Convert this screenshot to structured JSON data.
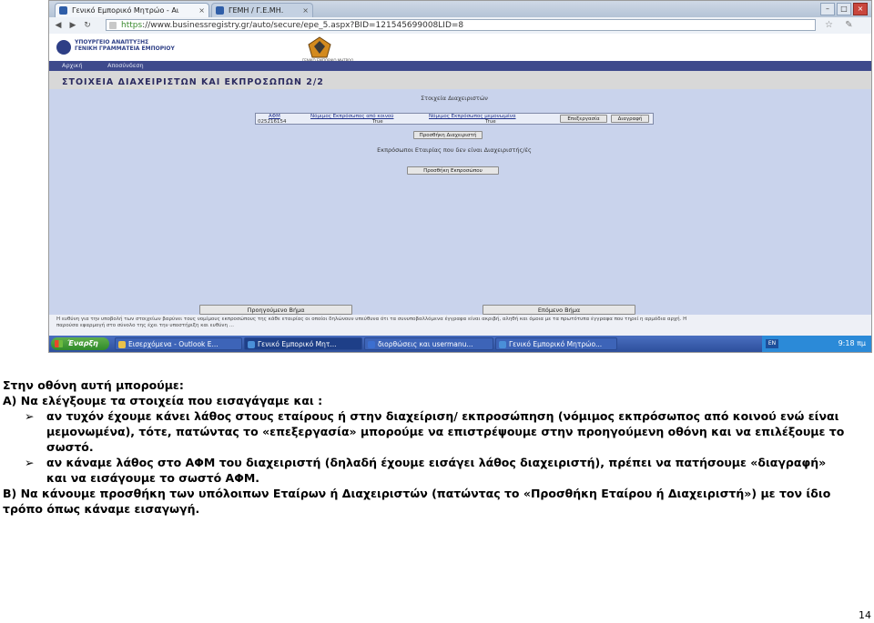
{
  "browser": {
    "tabs": [
      {
        "label": "Γενικό Εμπορικό Μητρώο - Αι",
        "active": true
      },
      {
        "label": "ΓΕΜΗ / Γ.Ε.ΜΗ.",
        "active": false
      }
    ],
    "url_scheme": "https",
    "url_rest": "://www.businessregistry.gr/auto/secure/epe_5.aspx?BID=121545699008LID=8"
  },
  "site": {
    "ministry_line1": "ΥΠΟΥΡΓΕΙΟ ΑΝΑΠΤΥΞΗΣ",
    "ministry_line2": "ΓΕΝΙΚΗ ΓΡΑΜΜΑΤΕΙΑ ΕΜΠΟΡΙΟΥ",
    "gemh_sub": "ΓΕΝΙΚΟ ΕΜΠΟΡΙΚΟ ΜΗΤΡΩΟ",
    "nav": [
      "Αρχική",
      "Αποσύνδεση"
    ],
    "page_title": "ΣΤΟΙΧΕΙΑ ΔΙΑΧΕΙΡΙΣΤΩΝ ΚΑΙ ΕΚΠΡΟΣΩΠΩΝ 2/2"
  },
  "form": {
    "managers_title": "Στοιχεία Διαχειριστών",
    "table_headers": [
      "ΑΦΜ",
      "Νόμιμος Εκπρόσωπος από κοινού",
      "Νόμιμος Εκπρόσωπος μεμονωμένα"
    ],
    "row": {
      "afm": "025216154",
      "joint": "True",
      "single": "True"
    },
    "edit_button": "Επεξεργασία",
    "delete_button": "Διαγραφή",
    "add_manager_button": "Προσθήκη Διαχειριστή",
    "reps_title": "Εκπρόσωποι Εταιρίας που δεν είναι Διαχειριστής/ές",
    "add_rep_button": "Προσθήκη Εκπροσώπου",
    "prev_button": "Προηγούμενο Βήμα",
    "next_button": "Επόμενο Βήμα",
    "footer_line1": "Η ευθύνη για την υποβολή των στοιχείων βαρύνει τους νομίμους εκπροσώπους της κάθε εταιρίας οι οποίοι δηλώνουν υπεύθυνα ότι τα συνυποβαλλόμενα έγγραφα είναι ακριβή, αληθή και όμοια με τα πρωτότυπα έγγραφα που τηρεί η αρμόδια αρχή. Η",
    "footer_line2": "παρούσα εφαρμογή στο σύνολο της έχει την υποστήριξη και ευθύνη ..."
  },
  "taskbar": {
    "start": "Έναρξη",
    "tasks": [
      {
        "label": "Εισερχόμενα - Outlook E...",
        "active": false
      },
      {
        "label": "Γενικό Εμπορικό Μητ...",
        "active": true
      },
      {
        "label": "διορθώσεις και usermanu...",
        "active": false
      },
      {
        "label": "Γενικό Εμπορικό Μητρώο...",
        "active": false
      }
    ],
    "lang": "EN",
    "clock": "9:18 πμ"
  },
  "doc": {
    "intro": "Στην οθόνη αυτή μπορούμε:",
    "a_heading": "Α) Να ελέγξουμε τα στοιχεία που εισαγάγαμε και :",
    "bullet1_line1": "αν τυχόν έχουμε κάνει λάθος στους εταίρους ή στην διαχείριση/ εκπροσώπηση (νόμιμος εκπρόσωπος από κοινού ενώ είναι",
    "bullet1_line2": "μεμονωμένα), τότε, πατώντας το «επεξεργασία» μπορούμε να επιστρέψουμε στην προηγούμενη οθόνη και να επιλέξουμε το",
    "bullet1_line3": "σωστό.",
    "bullet2_line1": "αν κάναμε λάθος στο ΑΦΜ του διαχειριστή (δηλαδή έχουμε εισάγει λάθος διαχειριστή), πρέπει να πατήσουμε «διαγραφή»",
    "bullet2_line2": "και να εισάγουμε το σωστό ΑΦΜ.",
    "b_line1": "Β) Να κάνουμε προσθήκη των υπόλοιπων Εταίρων ή Διαχειριστών (πατώντας το «Προσθήκη Εταίρου ή Διαχειριστή») με τον ίδιο",
    "b_line2": "τρόπο όπως κάναμε εισαγωγή.",
    "bullet_marker": "➢",
    "page_number": "14"
  }
}
